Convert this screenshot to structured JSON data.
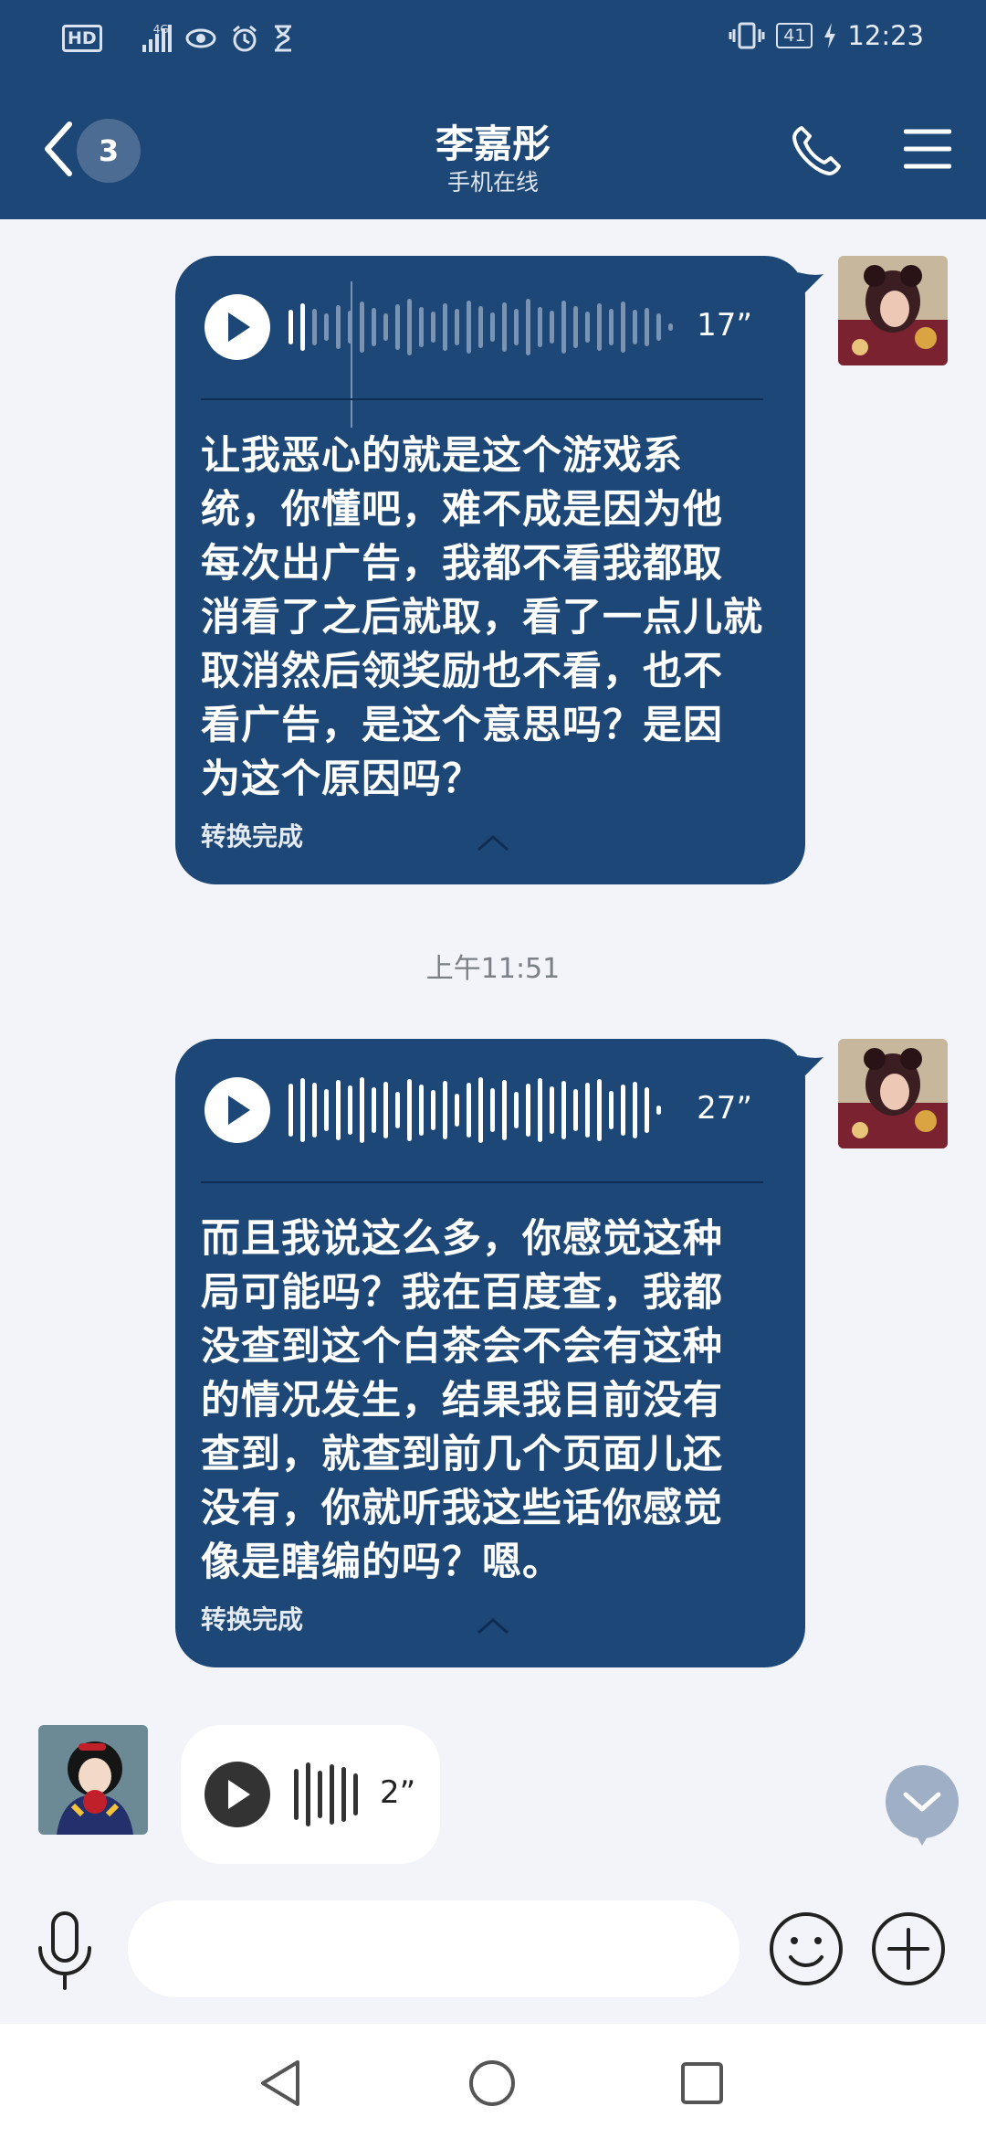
{
  "status_bar": {
    "hd": "HD",
    "network": "4G",
    "battery": "41",
    "time": "12:23"
  },
  "header": {
    "unread_count": "3",
    "contact_name": "李嘉彤",
    "presence": "手机在线"
  },
  "messages": [
    {
      "sender": "self",
      "type": "voice",
      "duration": "17”",
      "transcript": "让我恶心的就是这个游戏系\n统，你懂吧，难不成是因为他\n每次出广告，我都不看我都取\n消看了之后就取，看了一点儿就\n取消然后领奖励也不看，也不\n看广告，是这个意思吗？是因\n为这个原因吗？",
      "status": "转换完成"
    },
    {
      "sender": "self",
      "type": "voice",
      "duration": "27”",
      "transcript": "而且我说这么多，你感觉这种\n局可能吗？我在百度查，我都\n没查到这个白茶会不会有这种\n的情况发生，结果我目前没有\n查到，就查到前几个页面儿还\n没有，你就听我这些话你感觉\n像是瞎编的吗？嗯。",
      "status": "转换完成"
    },
    {
      "sender": "other",
      "type": "voice",
      "duration": "2”"
    }
  ],
  "timestamp": "上午11:51",
  "composer": {
    "placeholder": ""
  },
  "colors": {
    "header_bg": "#1d4776",
    "bubble_self": "#1d4776",
    "bubble_other": "#ffffff",
    "page_bg": "#f3f4f9"
  },
  "icons": [
    "back-chevron-icon",
    "phone-icon",
    "menu-icon",
    "play-icon",
    "mic-icon",
    "emoji-icon",
    "plus-icon",
    "scroll-down-icon",
    "nav-back-icon",
    "nav-home-icon",
    "nav-recent-icon"
  ]
}
